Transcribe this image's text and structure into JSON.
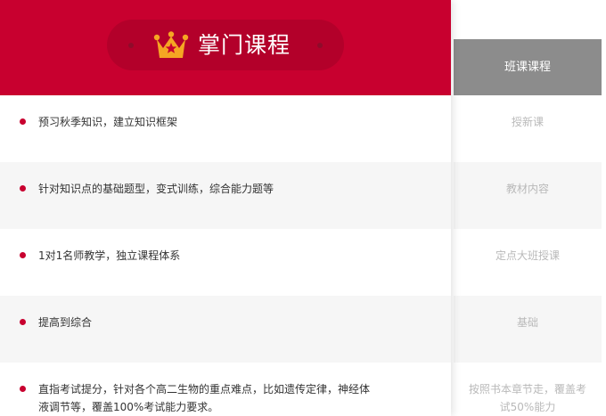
{
  "header": {
    "title": "掌门课程",
    "icon": "crown-icon",
    "colors": {
      "brand": "#c8002f",
      "pill": "#b3002a",
      "crown": "#f5a623"
    }
  },
  "comparison": {
    "header": "班课课程",
    "header_color": "#8c8c8c"
  },
  "rows": [
    {
      "main": "预习秋季知识，建立知识框架",
      "compare": "授新课"
    },
    {
      "main": "针对知识点的基础题型，变式训练，综合能力题等",
      "compare": "教材内容"
    },
    {
      "main": "1对1名师教学，独立课程体系",
      "compare": "定点大班授课"
    },
    {
      "main": "提高到综合",
      "compare": "基础"
    },
    {
      "main": "直指考试提分，针对各个高二生物的重点难点，比如遗传定律，神经体液调节等，覆盖100%考试能力要求。",
      "compare": "按照书本章节走，覆盖考试50%能力"
    }
  ]
}
